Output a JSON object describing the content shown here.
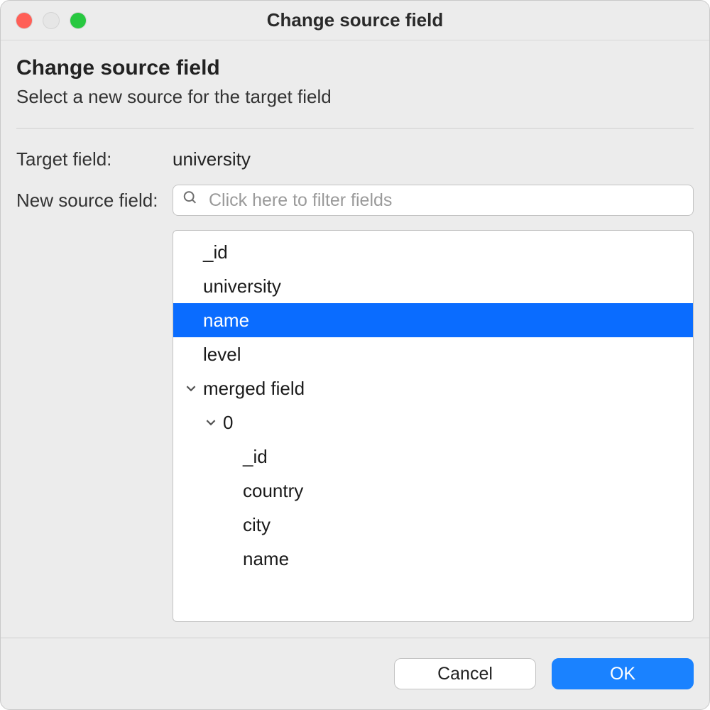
{
  "window_title": "Change source field",
  "header": {
    "title": "Change source field",
    "subtitle": "Select a new source for the target field"
  },
  "target_field_label": "Target field:",
  "target_field_value": "university",
  "new_source_label": "New source field:",
  "search_placeholder": "Click here to filter fields",
  "tree": [
    {
      "label": "_id",
      "depth": 0,
      "selected": false,
      "expandable": false
    },
    {
      "label": "university",
      "depth": 0,
      "selected": false,
      "expandable": false
    },
    {
      "label": "name",
      "depth": 0,
      "selected": true,
      "expandable": false
    },
    {
      "label": "level",
      "depth": 0,
      "selected": false,
      "expandable": false
    },
    {
      "label": "merged field",
      "depth": 0,
      "selected": false,
      "expandable": true,
      "expanded": true
    },
    {
      "label": "0",
      "depth": 1,
      "selected": false,
      "expandable": true,
      "expanded": true
    },
    {
      "label": "_id",
      "depth": 2,
      "selected": false,
      "expandable": false
    },
    {
      "label": "country",
      "depth": 2,
      "selected": false,
      "expandable": false
    },
    {
      "label": "city",
      "depth": 2,
      "selected": false,
      "expandable": false
    },
    {
      "label": "name",
      "depth": 2,
      "selected": false,
      "expandable": false
    }
  ],
  "buttons": {
    "cancel": "Cancel",
    "ok": "OK"
  }
}
